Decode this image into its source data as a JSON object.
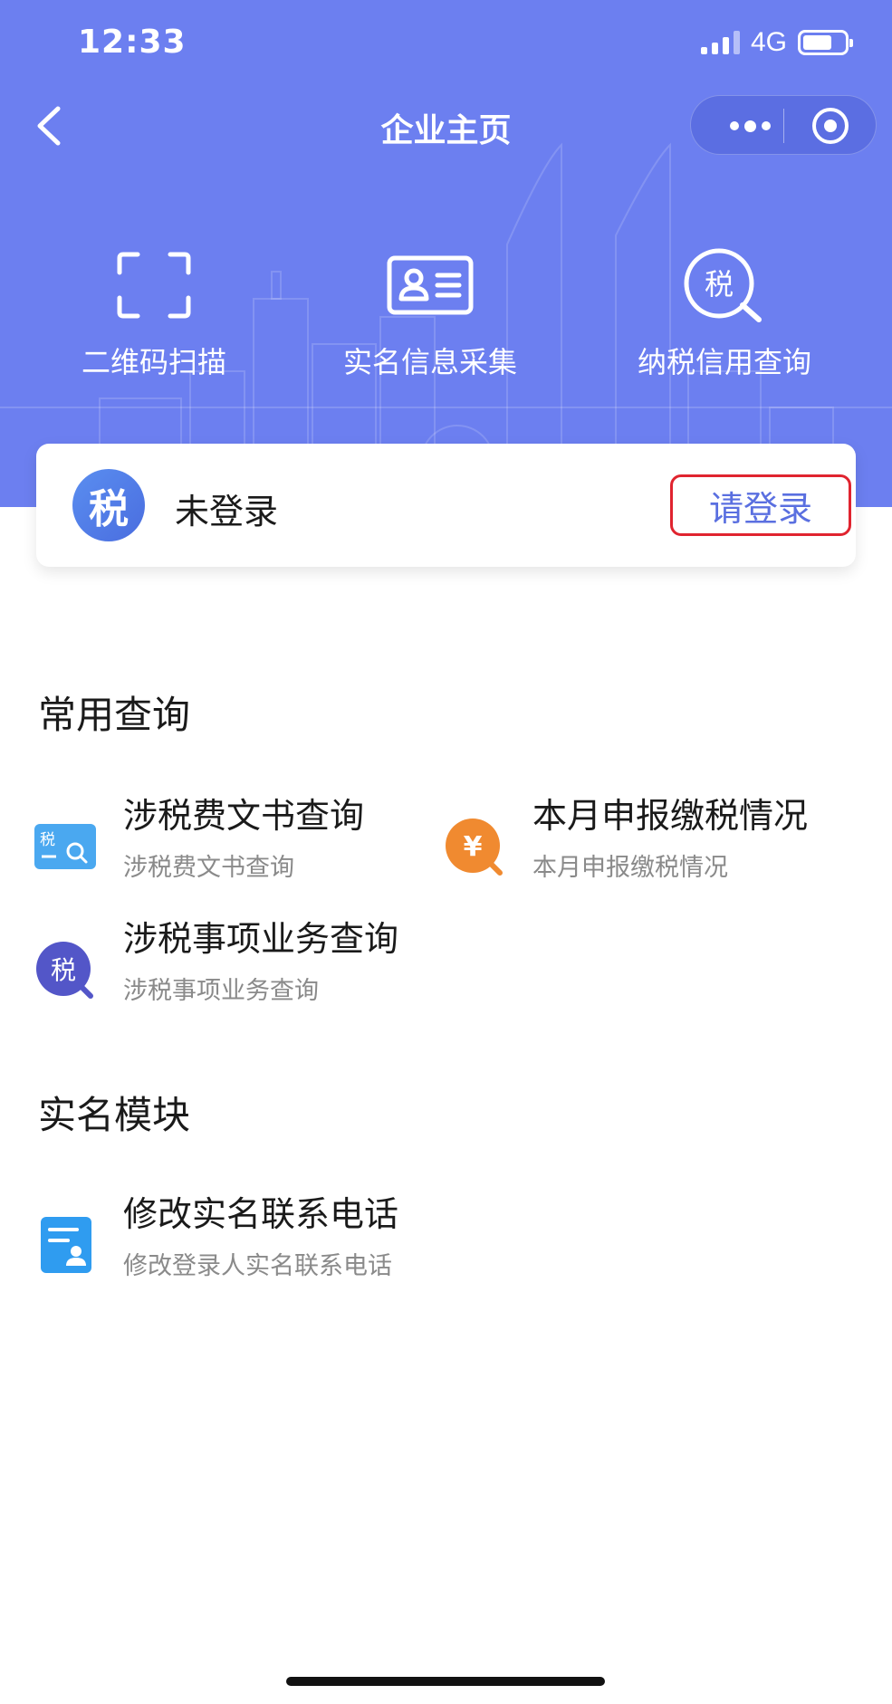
{
  "status_bar": {
    "time": "12:33",
    "network": "4G",
    "battery_level": 0.7
  },
  "nav": {
    "title": "企业主页"
  },
  "quick_actions": [
    {
      "label": "二维码扫描"
    },
    {
      "label": "实名信息采集"
    },
    {
      "label": "纳税信用查询",
      "icon_text": "税"
    }
  ],
  "login_card": {
    "avatar_text": "税",
    "status": "未登录",
    "button": "请登录",
    "button_highlight_color": "#e0242f"
  },
  "sections": {
    "common": {
      "title": "常用查询",
      "items": [
        {
          "title": "涉税费文书查询",
          "subtitle": "涉税费文书查询",
          "icon": "tax-search-icon",
          "icon_text": "税"
        },
        {
          "title": "本月申报缴税情况",
          "subtitle": "本月申报缴税情况",
          "icon": "yuan-search-icon",
          "icon_text": "¥"
        },
        {
          "title": "涉税事项业务查询",
          "subtitle": "涉税事项业务查询",
          "icon": "tax-badge-icon",
          "icon_text": "税"
        }
      ]
    },
    "realname": {
      "title": "实名模块",
      "items": [
        {
          "title": "修改实名联系电话",
          "subtitle": "修改登录人实名联系电话",
          "icon": "contact-card-icon"
        }
      ]
    }
  },
  "colors": {
    "header_blue": "#6c7ff0",
    "accent_blue": "#5a6fe0",
    "orange": "#f08a30"
  }
}
